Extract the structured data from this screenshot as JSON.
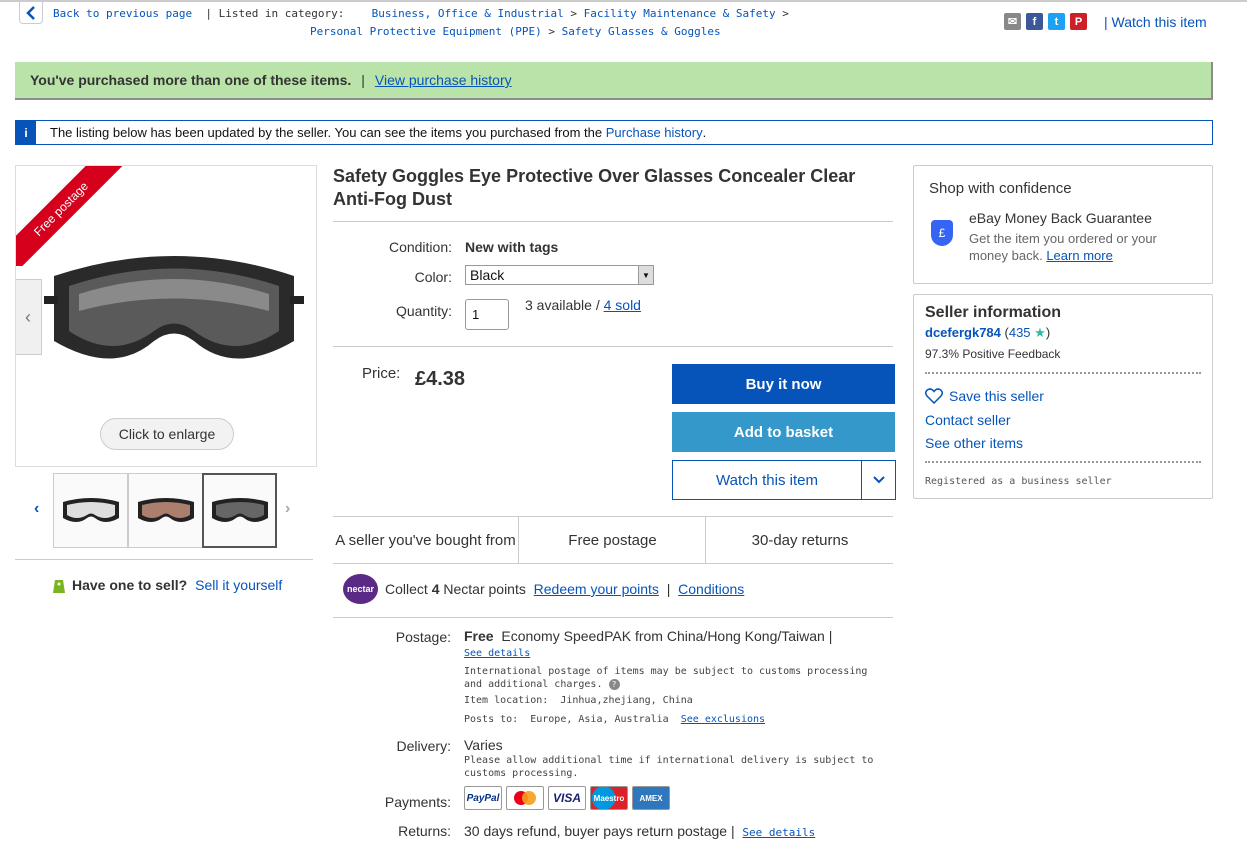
{
  "breadcrumb": {
    "back": "Back to previous page",
    "listed": "Listed in category:",
    "cat1": "Business, Office & Industrial",
    "cat2": "Facility Maintenance & Safety",
    "cat3": "Personal Protective Equipment (PPE)",
    "cat4": "Safety Glasses & Goggles",
    "sep": ">"
  },
  "share": {
    "icons": [
      "email-icon",
      "facebook-icon",
      "twitter-icon",
      "pinterest-icon"
    ],
    "divider": "|",
    "watch": "Watch this item"
  },
  "purchase_banner": {
    "text": "You've purchased more than one of these items.",
    "sep": "|",
    "link": "View purchase history",
    "color": "#b9e3a8"
  },
  "notice": {
    "icon": "i",
    "text": "The listing below has been updated by the seller. You can see the items you purchased from the ",
    "link": "Purchase history",
    "end": "."
  },
  "gallery": {
    "ribbon": "Free postage",
    "enlarge": "Click to enlarge"
  },
  "sell": {
    "q": "Have one to sell?",
    "link": "Sell it yourself"
  },
  "item": {
    "title": "Safety Goggles Eye Protective Over Glasses Concealer Clear Anti-Fog Dust",
    "condition_label": "Condition:",
    "condition": "New with tags",
    "color_label": "Color:",
    "color": "Black",
    "qty_label": "Quantity:",
    "qty": "1",
    "available": "3 available / ",
    "sold": "4 sold",
    "price_label": "Price:",
    "price": "£4.38"
  },
  "buttons": {
    "buy": "Buy it now",
    "basket": "Add to basket",
    "watch": "Watch this item",
    "buy_color": "#0654ba",
    "basket_color": "#3498ca"
  },
  "features": [
    "A seller you've bought from",
    "Free postage",
    "30-day returns"
  ],
  "nectar": {
    "logo": "nectar",
    "pre": "Collect ",
    "points": "4",
    "post": " Nectar points",
    "redeem": "Redeem your points",
    "sep": "|",
    "conditions": "Conditions"
  },
  "postage": {
    "label": "Postage:",
    "free": "Free",
    "service": "Economy SpeedPAK from China/Hong Kong/Taiwan |",
    "details": "See details",
    "intl": "International postage of items may be subject to customs processing and additional charges.",
    "help": "?",
    "location": "Item location:  Jinhua,zhejiang, China",
    "posts_to": "Posts to:  Europe, Asia, Australia",
    "exclusions": "See exclusions"
  },
  "delivery": {
    "label": "Delivery:",
    "value": "Varies",
    "note": "Please allow additional time if international delivery is subject to customs processing."
  },
  "payments": {
    "label": "Payments:",
    "methods": [
      "PayPal",
      "mastercard",
      "VISA",
      "Maestro",
      "AMEX"
    ]
  },
  "returns": {
    "label": "Returns:",
    "value": "30 days refund, buyer pays return postage |",
    "details": "See details"
  },
  "confidence": {
    "title": "Shop with confidence",
    "head": "eBay Money Back Guarantee",
    "body": "Get the item you ordered or your money back.",
    "link": "Learn more",
    "shield": "£"
  },
  "seller": {
    "title": "Seller information",
    "name": "dcefergk784",
    "open": " (",
    "score": "435",
    "close": ")",
    "feedback": "97.3% Positive Feedback",
    "save": "Save this seller",
    "contact": "Contact seller",
    "other": "See other items",
    "registered": "Registered as a business seller"
  }
}
